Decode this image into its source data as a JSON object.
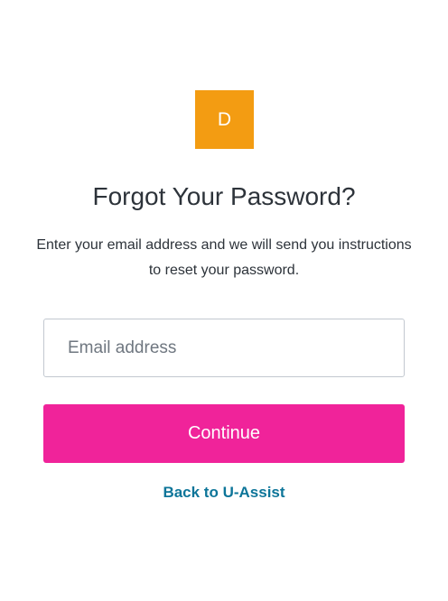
{
  "logo": {
    "letter": "D",
    "color": "#f39c12"
  },
  "heading": "Forgot Your Password?",
  "instructions": "Enter your email address and we will send you instructions to reset your password.",
  "email": {
    "placeholder": "Email address",
    "value": ""
  },
  "continue_label": "Continue",
  "back_link_label": "Back to U-Assist",
  "colors": {
    "accent": "#f0239a",
    "link": "#0d7599",
    "logo_bg": "#f39c12"
  }
}
